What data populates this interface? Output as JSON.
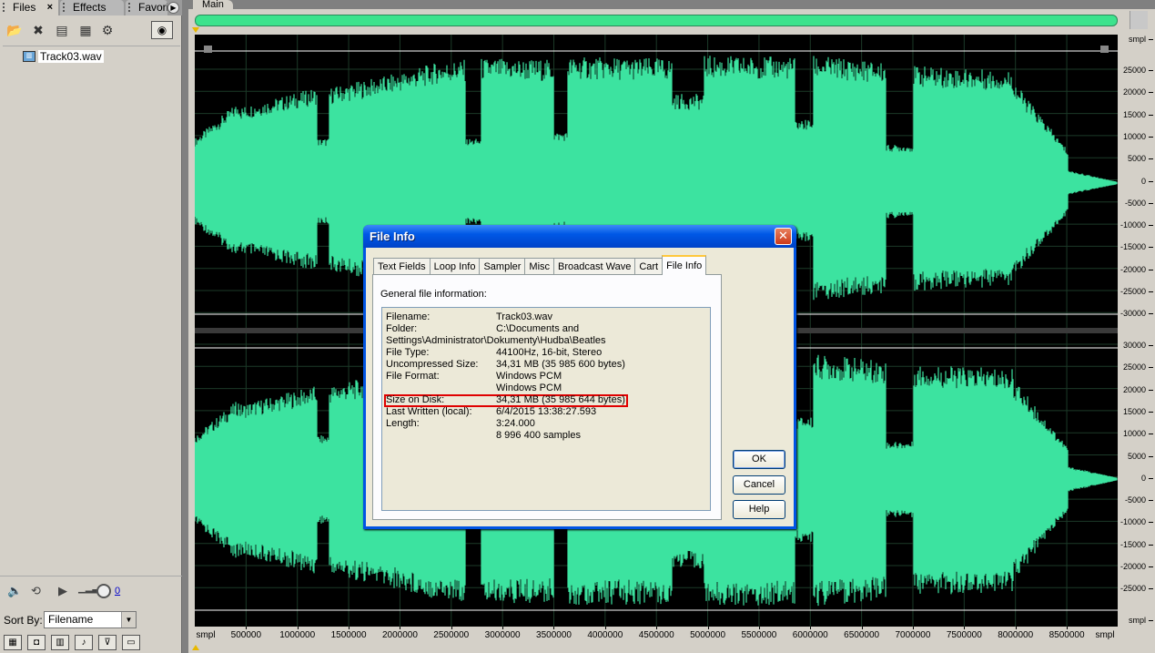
{
  "left_panel": {
    "tabs": [
      {
        "label": "Files",
        "close": "×"
      },
      {
        "label": "Effects"
      },
      {
        "label": "Favorites"
      }
    ],
    "files": [
      {
        "name": "Track03.wav",
        "icon": "wav-file-icon"
      }
    ],
    "volume_value": "0",
    "sort_by_label": "Sort By:",
    "sort_by_value": "Filename"
  },
  "main": {
    "tab_label": "Main",
    "waveform_color": "#3ce3a0",
    "amplitude_unit": "smpl",
    "amplitude_labels_top": [
      "25000",
      "20000",
      "15000",
      "10000",
      "5000",
      "0",
      "-5000",
      "-10000",
      "-15000",
      "-20000",
      "-25000",
      "-30000"
    ],
    "amplitude_labels_bottom": [
      "30000",
      "25000",
      "20000",
      "15000",
      "10000",
      "5000",
      "0",
      "-5000",
      "-10000",
      "-15000",
      "-20000",
      "-25000"
    ],
    "bottom_unit": "smpl",
    "time_unit": "smpl",
    "time_labels": [
      "500000",
      "1000000",
      "1500000",
      "2000000",
      "2500000",
      "3000000",
      "3500000",
      "4000000",
      "4500000",
      "5000000",
      "5500000",
      "6000000",
      "6500000",
      "7000000",
      "7500000",
      "8000000",
      "8500000"
    ]
  },
  "dialog": {
    "title": "File Info",
    "close_glyph": "✕",
    "tabs": [
      "Text Fields",
      "Loop Info",
      "Sampler",
      "Misc",
      "Broadcast Wave",
      "Cart",
      "File Info"
    ],
    "active_tab": "File Info",
    "heading": "General file information:",
    "rows": [
      {
        "key": "Filename:",
        "value": "Track03.wav"
      },
      {
        "key": "Folder:",
        "value": "C:\\Documents and"
      },
      {
        "key": "Settings\\Administrator\\Dokumenty\\Hudba\\Beatles",
        "value": ""
      },
      {
        "key": "File Type:",
        "value": "44100Hz, 16-bit, Stereo"
      },
      {
        "key": "Uncompressed Size:",
        "value": "34,31 MB (35 985 600 bytes)"
      },
      {
        "key": "File Format:",
        "value": "Windows PCM"
      },
      {
        "key": "",
        "value": "Windows PCM"
      },
      {
        "key": "Size on Disk:",
        "value": "34,31 MB (35 985 644 bytes)"
      },
      {
        "key": "Last Written (local):",
        "value": "6/4/2015  13:38:27.593"
      },
      {
        "key": "Length:",
        "value": "3:24.000"
      },
      {
        "key": "",
        "value": "8 996 400 samples"
      }
    ],
    "buttons": {
      "ok": "OK",
      "cancel": "Cancel",
      "help": "Help"
    }
  }
}
